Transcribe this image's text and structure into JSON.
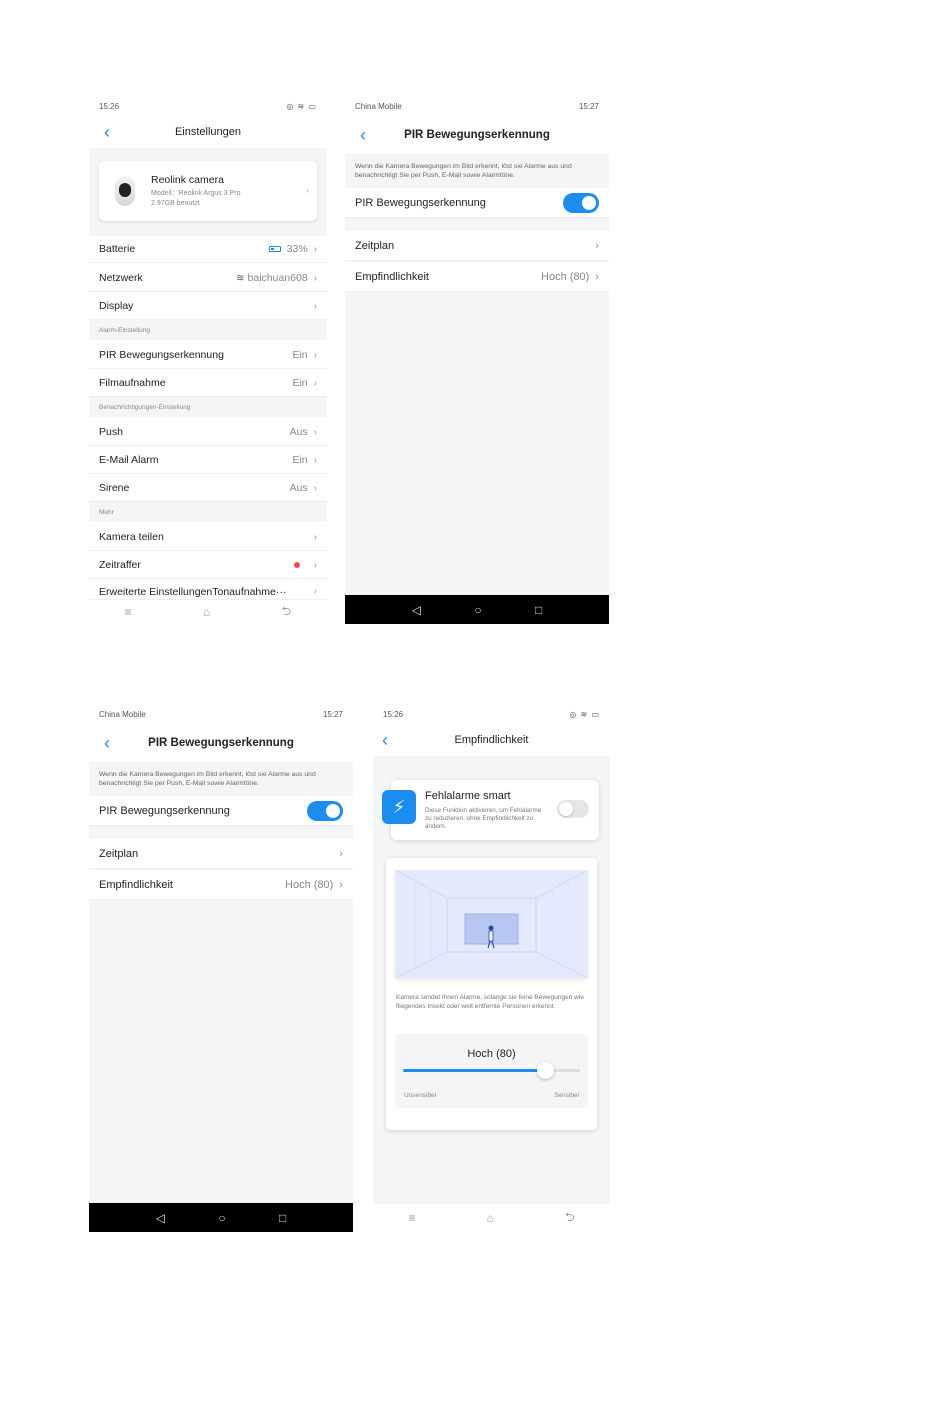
{
  "panel1": {
    "status": {
      "left": "15:26",
      "right": "◎ ≋ ▭"
    },
    "title": "Einstellungen",
    "device": {
      "name": "Reolink camera",
      "model": "Modell：Reolink Argus 3 Pro",
      "storage": "2.97GB benutzt"
    },
    "rows": {
      "battery": {
        "label": "Batterie",
        "value": "33%"
      },
      "network": {
        "label": "Netzwerk",
        "value": "baichuan608"
      },
      "display": {
        "label": "Display"
      }
    },
    "section_alarm": "Alarm-Einstellung",
    "alarm_rows": {
      "pir": {
        "label": "PIR Bewegungserkennung",
        "value": "Ein"
      },
      "record": {
        "label": "Filmaufnahme",
        "value": "Ein"
      }
    },
    "section_notify": "Benachrichtigungen-Einstellung",
    "notify_rows": {
      "push": {
        "label": "Push",
        "value": "Aus"
      },
      "email": {
        "label": "E-Mail Alarm",
        "value": "Ein"
      },
      "siren": {
        "label": "Sirene",
        "value": "Aus"
      }
    },
    "section_more": "Mehr",
    "more_rows": {
      "share": {
        "label": "Kamera teilen"
      },
      "timelapse": {
        "label": "Zeitraffer"
      },
      "advanced": {
        "label": "Erweiterte EinstellungenTonaufnahme···"
      }
    }
  },
  "pir_screen": {
    "status_left": "China Mobile",
    "status_time": "15:27",
    "title": "PIR Bewegungserkennung",
    "description": "Wenn die Kamera Bewegungen im Bild erkennt, löst sie Alarme aus und benachrichtigt Sie per Push, E-Mail sowie Alarmtöne.",
    "toggle_label": "PIR Bewegungserkennung",
    "toggle_on": true,
    "schedule_label": "Zeitplan",
    "sensitivity_label": "Empfindlichkeit",
    "sensitivity_value": "Hoch (80)"
  },
  "panel4": {
    "status_time": "15:26",
    "title": "Empfindlichkeit",
    "smart": {
      "title": "Fehlalarme smart",
      "description": "Diese Funktion aktivieren, um Fehlalarme zu reduzieren, ohne Empfindlichkeit zu ändern.",
      "enabled": false
    },
    "illustration_desc": "Kamera sendet Ihnen Alarme, solange sie feine Bewegungen wie fliegendes Insekt oder weit entfernte Personen erkennt.",
    "slider": {
      "value_label": "Hoch (80)",
      "value": 80,
      "max": 100,
      "min_label": "Unsensibel",
      "max_label": "Sensibel"
    }
  },
  "colors": {
    "accent": "#1b8cf0",
    "alert": "#f24a4a"
  },
  "icons": [
    "back-arrow-icon",
    "chevron-right-icon",
    "battery-icon",
    "wifi-icon",
    "running-person-icon",
    "menu-icon",
    "home-icon",
    "return-icon",
    "triangle-back-icon",
    "circle-home-icon",
    "square-recents-icon"
  ]
}
